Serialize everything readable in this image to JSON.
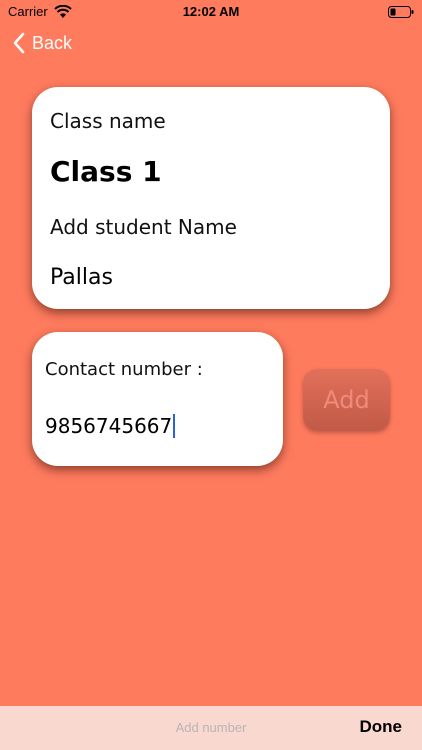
{
  "status_bar": {
    "carrier": "Carrier",
    "time": "12:02 AM"
  },
  "nav": {
    "back_label": "Back"
  },
  "class_card": {
    "class_name_label": "Class name",
    "class_name_value": "Class 1",
    "student_label": "Add student Name",
    "student_value": "Pallas"
  },
  "contact_card": {
    "label": "Contact number :",
    "value": "9856745667"
  },
  "add_button": {
    "label": "Add"
  },
  "keyboard_toolbar": {
    "placeholder": "Add number",
    "done_label": "Done"
  },
  "colors": {
    "background": "#ff7b5e",
    "card": "#ffffff",
    "add_button": "#d9654f",
    "toolbar": "#f9d9cf",
    "caret": "#2b63d6"
  }
}
